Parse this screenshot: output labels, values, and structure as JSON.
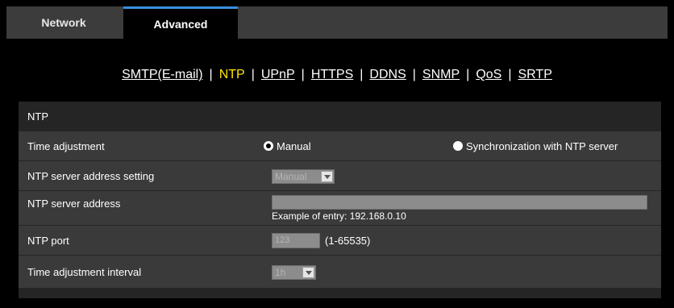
{
  "tabs": {
    "network": "Network",
    "advanced": "Advanced"
  },
  "subnav": {
    "items": [
      "SMTP(E-mail)",
      "NTP",
      "UPnP",
      "HTTPS",
      "DDNS",
      "SNMP",
      "QoS",
      "SRTP"
    ],
    "current": "NTP",
    "separator": "|"
  },
  "panel": {
    "title": "NTP",
    "time_adjustment": {
      "label": "Time adjustment",
      "option_manual": "Manual",
      "option_ntp": "Synchronization with NTP server",
      "selected": "Manual"
    },
    "ntp_server_address_setting": {
      "label": "NTP server address setting",
      "value": "Manual"
    },
    "ntp_server_address": {
      "label": "NTP server address",
      "value": "",
      "example": "Example of entry: 192.168.0.10"
    },
    "ntp_port": {
      "label": "NTP port",
      "value": "123",
      "range": "(1-65535)"
    },
    "time_adjustment_interval": {
      "label": "Time adjustment interval",
      "value": "1h"
    }
  },
  "colors": {
    "accent_tab": "#3a8ee0",
    "current_link": "#ffe600",
    "row_bg": "#3a3a3a",
    "header_bg": "#252525"
  }
}
